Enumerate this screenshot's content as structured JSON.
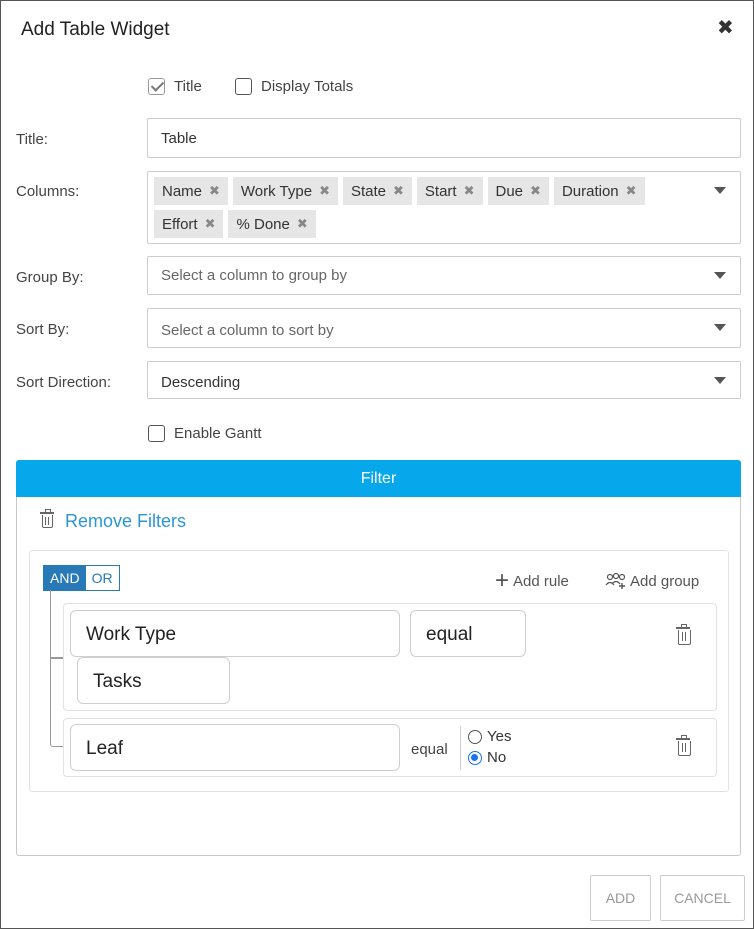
{
  "dialog": {
    "title": "Add Table Widget",
    "close_glyph": "✖"
  },
  "options": {
    "title_checkbox": {
      "label": "Title",
      "checked": true
    },
    "display_totals": {
      "label": "Display Totals",
      "checked": false
    },
    "enable_gantt": {
      "label": "Enable Gantt",
      "checked": false
    }
  },
  "form": {
    "title_label": "Title:",
    "title_value": "Table",
    "columns_label": "Columns:",
    "columns": [
      "Name",
      "Work Type",
      "State",
      "Start",
      "Due",
      "Duration",
      "Effort",
      "% Done"
    ],
    "chip_remove_glyph": "✖",
    "group_by_label": "Group By:",
    "group_by_placeholder": "Select a column to group by",
    "sort_by_label": "Sort By:",
    "sort_by_placeholder": "Select a column to sort by",
    "sort_direction_label": "Sort Direction:",
    "sort_direction_value": "Descending"
  },
  "filter": {
    "header": "Filter",
    "remove_filters": "Remove Filters",
    "and_label": "AND",
    "or_label": "OR",
    "add_rule": "Add rule",
    "add_group": "Add group",
    "rules": [
      {
        "field": "Work Type",
        "operator": "equal",
        "value": "Tasks"
      },
      {
        "field": "Leaf",
        "operator": "equal",
        "options": [
          "Yes",
          "No"
        ],
        "selected": "No"
      }
    ]
  },
  "footer": {
    "add": "ADD",
    "cancel": "CANCEL"
  },
  "colors": {
    "accent": "#07a7ec",
    "link": "#2b97d2",
    "toggle": "#2879b8"
  }
}
